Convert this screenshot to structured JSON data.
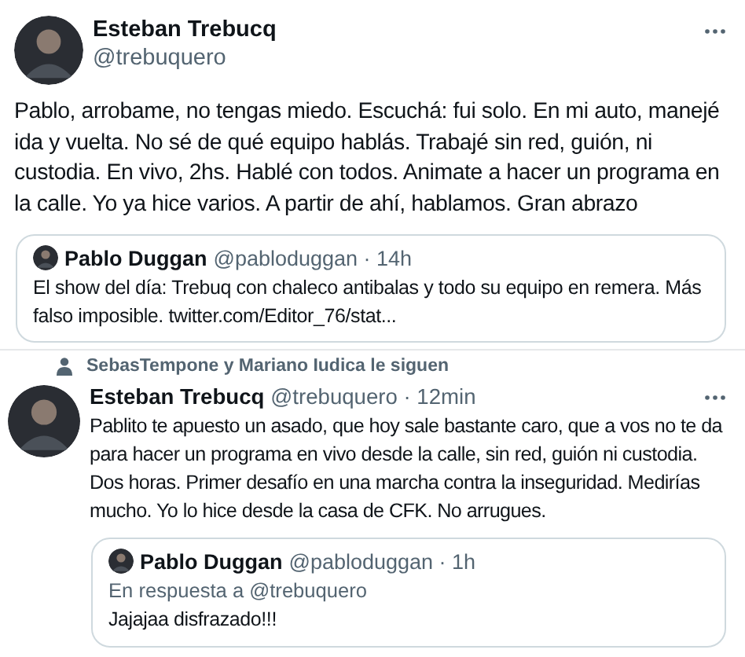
{
  "tweets": [
    {
      "kind": "detail",
      "author": {
        "name": "Esteban Trebucq",
        "handle": "@trebuquero"
      },
      "text": "Pablo, arrobame, no tengas miedo. Escuchá: fui solo. En mi auto, manejé ida y vuelta. No sé de qué equipo hablás. Trabajé sin red, guión, ni custodia. En vivo, 2hs. Hablé con todos. Animate a hacer un programa en la calle. Yo ya hice varios. A partir de ahí, hablamos. Gran abrazo",
      "quote": {
        "name": "Pablo Duggan",
        "meta": "@pabloduggan · 14h",
        "text": "El show del día: Trebuq con chaleco antibalas y todo su equipo en remera. Más falso imposible. twitter.com/Editor_76/stat..."
      }
    },
    {
      "kind": "timeline",
      "social_context": "SebasTempone y Mariano Iudica le siguen",
      "author": {
        "name": "Esteban Trebucq",
        "handle": "@trebuquero · 12min"
      },
      "text": "Pablito te apuesto un asado, que hoy sale bastante caro, que a vos no te da para hacer un programa en vivo desde la calle, sin red, guión ni custodia. Dos horas. Primer desafío en una marcha contra la inseguridad. Medirías mucho. Yo lo hice desde la casa de CFK. No arrugues.",
      "quote": {
        "name": "Pablo Duggan",
        "meta": "@pabloduggan · 1h",
        "reply_to": "En respuesta a @trebuquero",
        "text": "Jajajaa disfrazado!!!"
      }
    }
  ]
}
